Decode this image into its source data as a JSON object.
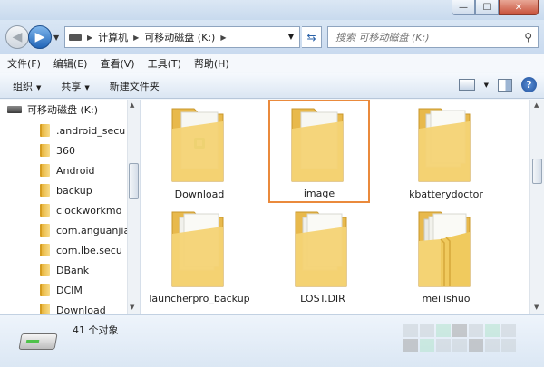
{
  "window": {
    "min_glyph": "—",
    "max_glyph": "☐",
    "close_glyph": "✕"
  },
  "address": {
    "crumbs": [
      "计算机",
      "可移动磁盘 (K:)"
    ]
  },
  "search": {
    "placeholder": "搜索 可移动磁盘 (K:)"
  },
  "menu": [
    "文件(F)",
    "编辑(E)",
    "查看(V)",
    "工具(T)",
    "帮助(H)"
  ],
  "commands": {
    "organize": "组织",
    "share": "共享",
    "new_folder": "新建文件夹"
  },
  "tree": {
    "root": "可移动磁盘 (K:)",
    "children": [
      ".android_secu",
      "360",
      "Android",
      "backup",
      "clockworkmo",
      "com.anguanjia",
      "com.lbe.secu",
      "DBank",
      "DCIM",
      "Download"
    ]
  },
  "items": [
    {
      "label": "Download",
      "kind": "folder-with-app"
    },
    {
      "label": "image",
      "kind": "folder-empty",
      "selected": true
    },
    {
      "label": "kbatterydoctor",
      "kind": "folder-docs"
    },
    {
      "label": "launcherpro_backup",
      "kind": "folder-docs"
    },
    {
      "label": "LOST.DIR",
      "kind": "folder-docs"
    },
    {
      "label": "meilishuo",
      "kind": "folder-stack"
    }
  ],
  "status": {
    "count": "41 个对象"
  },
  "colors": {
    "selection": "#ea8a3c",
    "folder": "#f2c85a",
    "accent": "#2165b8"
  }
}
